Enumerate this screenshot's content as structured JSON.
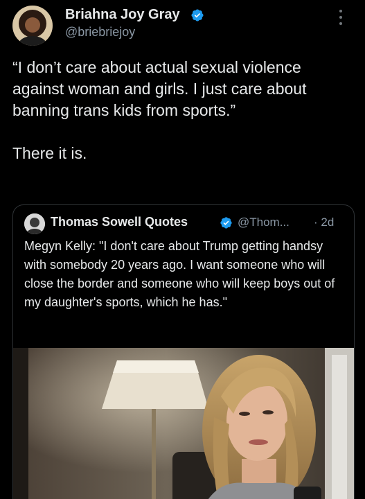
{
  "post": {
    "author_name": "Briahna Joy Gray",
    "author_handle": "@briebriejoy",
    "verified_icon": "verified-badge-icon",
    "more_icon": "more-vertical-icon",
    "text_lines": [
      "“I don’t care about actual sexual violence against woman and girls. I just care about banning trans kids from sports.”",
      "There it is."
    ]
  },
  "quote": {
    "author_name": "Thomas Sowell Quotes",
    "author_handle": "@Thom...",
    "time": "· 2d",
    "verified_icon": "verified-badge-icon",
    "text": "Megyn Kelly: \"I don't care about Trump getting handsy with somebody 20 years ago. I want someone who will close the border and someone who will keep boys out of my daughter's sports, which he has.\"",
    "media_icon": "video-thumbnail-image"
  },
  "colors": {
    "background": "#000000",
    "text_primary": "#e7e9ea",
    "text_secondary": "#8b98a5",
    "verified_blue": "#1d9bf0",
    "border": "#2f3336"
  }
}
